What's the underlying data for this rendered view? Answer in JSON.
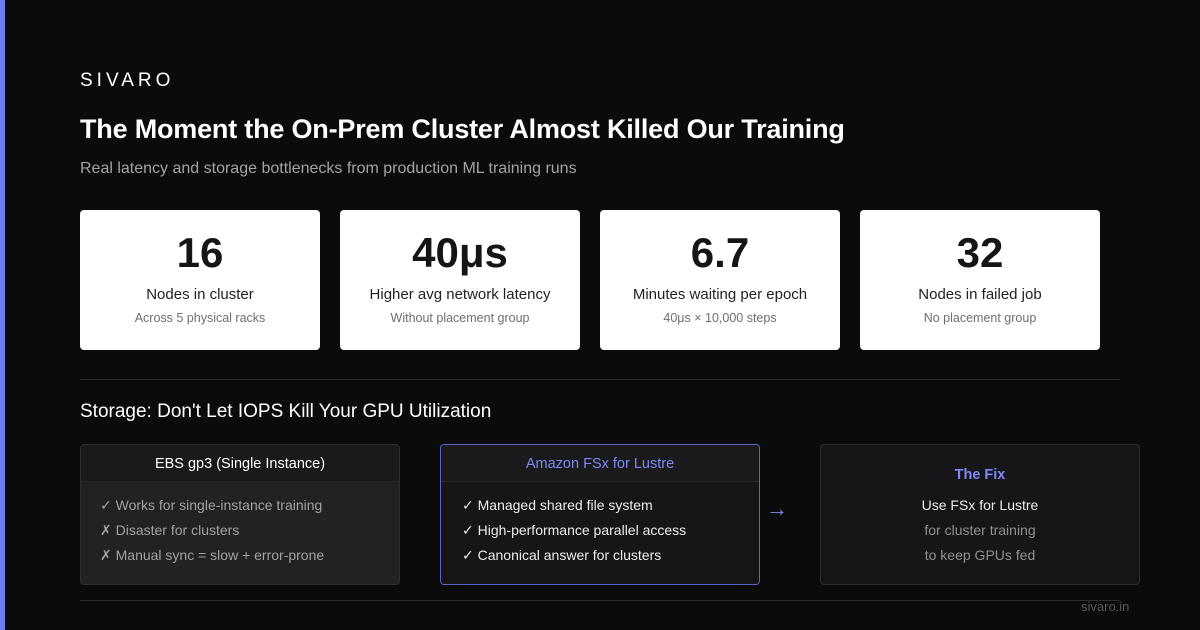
{
  "brand": "SIVARO",
  "title": "The Moment the On-Prem Cluster Almost Killed Our Training",
  "subtitle": "Real latency and storage bottlenecks from production ML training runs",
  "stats": [
    {
      "value": "16",
      "label": "Nodes in cluster",
      "sub": "Across 5 physical racks"
    },
    {
      "value": "40μs",
      "label": "Higher avg network latency",
      "sub": "Without placement group"
    },
    {
      "value": "6.7",
      "label": "Minutes waiting per epoch",
      "sub": "40μs × 10,000 steps"
    },
    {
      "value": "32",
      "label": "Nodes in failed job",
      "sub": "No placement group"
    }
  ],
  "section_title": "Storage: Don't Let IOPS Kill Your GPU Utilization",
  "ebs": {
    "title": "EBS gp3 (Single Instance)",
    "items": [
      "✓ Works for single-instance training",
      "✗ Disaster for clusters",
      "✗ Manual sync = slow + error-prone"
    ]
  },
  "fsx": {
    "title": "Amazon FSx for Lustre",
    "items": [
      "✓ Managed shared file system",
      "✓ High-performance parallel access",
      "✓ Canonical answer for clusters"
    ]
  },
  "arrow": "→",
  "fix": {
    "title": "The Fix",
    "lines": [
      "Use FSx for Lustre",
      "for cluster training",
      "to keep GPUs fed"
    ]
  },
  "footer_url": "sivaro.in",
  "colors": {
    "accent": "#6f79f2",
    "background": "#0b0b0c",
    "card": "#ffffff"
  }
}
